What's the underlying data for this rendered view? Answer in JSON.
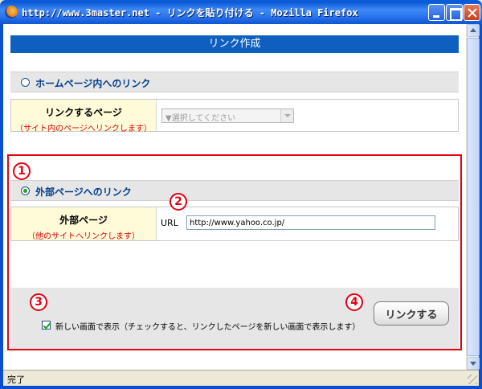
{
  "window": {
    "title": "http://www.3master.net - リンクを貼り付ける - Mozilla Firefox"
  },
  "page": {
    "header": "リンク作成"
  },
  "internal_link": {
    "section_label": "ホームページ内へのリンク",
    "selected": false,
    "field_label": "リンクするページ",
    "field_hint": "（サイト内のページへリンクします）",
    "select_placeholder": "▼選択してください"
  },
  "external_link": {
    "section_label": "外部ページへのリンク",
    "selected": true,
    "field_label": "外部ページ",
    "field_hint": "（他のサイトへリンクします）",
    "url_label": "URL",
    "url_value": "http://www.yahoo.co.jp/"
  },
  "options": {
    "new_window_checked": true,
    "new_window_label": "新しい画面で表示（チェックすると、リンクしたページを新しい画面で表示します）",
    "submit_label": "リンクする"
  },
  "annotations": {
    "m1": "1",
    "m2": "2",
    "m3": "3",
    "m4": "4"
  },
  "status": {
    "text": "完了"
  },
  "colors": {
    "header_bg": "#0e5fc0",
    "highlight": "#e60012",
    "label_bg": "#fffbd9",
    "hint_text": "#e00000",
    "section_text": "#003e8c"
  }
}
